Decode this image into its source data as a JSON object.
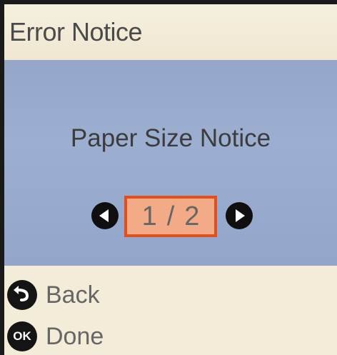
{
  "header": {
    "title": "Error Notice"
  },
  "notice": {
    "title": "Paper Size Notice"
  },
  "pager": {
    "current": "1",
    "separator": "/",
    "total": "2",
    "prev_icon": "triangle-left-icon",
    "next_icon": "triangle-right-icon"
  },
  "footer": {
    "back_label": "Back",
    "back_icon": "back-arrow-icon",
    "done_label": "Done",
    "done_icon_text": "OK",
    "done_icon": "ok-button-icon"
  },
  "colors": {
    "header_bg": "#f3ecd8",
    "content_bg": "#9cafd1",
    "page_box_border": "#e0501f",
    "page_box_fill": "#f3aa86"
  }
}
